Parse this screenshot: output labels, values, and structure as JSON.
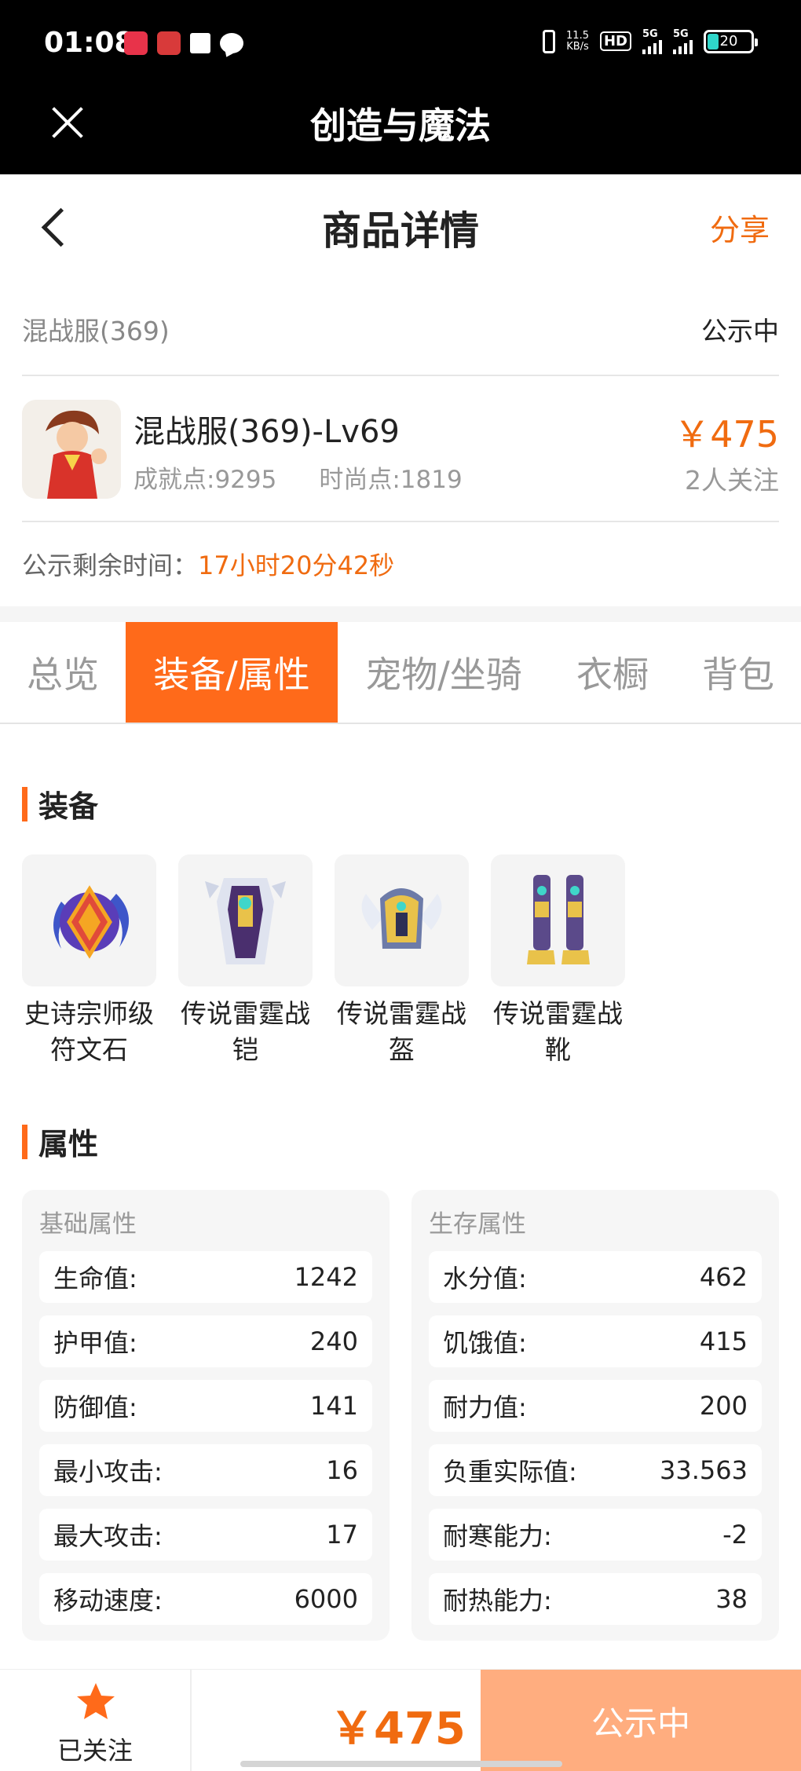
{
  "status_bar": {
    "time": "01:08",
    "speed_value": "11.5",
    "speed_unit": "KB/s",
    "hd": "HD",
    "net1": "5G",
    "net2": "5G",
    "battery": "20"
  },
  "app_bar": {
    "title": "创造与魔法"
  },
  "header": {
    "title": "商品详情",
    "share": "分享"
  },
  "server": {
    "name": "混战服(369)",
    "status": "公示中"
  },
  "product": {
    "title": "混战服(369)-Lv69",
    "achievement": "成就点:9295",
    "fashion": "时尚点:1819",
    "price": "￥475",
    "followers": "2人关注"
  },
  "timer": {
    "label": "公示剩余时间：",
    "value": "17小时20分42秒"
  },
  "tabs": [
    {
      "label": "总览"
    },
    {
      "label": "装备/属性"
    },
    {
      "label": "宠物/坐骑"
    },
    {
      "label": "衣橱"
    },
    {
      "label": "背包"
    }
  ],
  "equipment_section": {
    "title": "装备",
    "items": [
      {
        "line1": "史诗宗师级",
        "line2": "符文石",
        "icon": "rune-stone-icon"
      },
      {
        "line1": "传说雷霆战",
        "line2": "铠",
        "icon": "armor-icon"
      },
      {
        "line1": "传说雷霆战",
        "line2": "盔",
        "icon": "helmet-icon"
      },
      {
        "line1": "传说雷霆战",
        "line2": "靴",
        "icon": "boots-icon"
      }
    ]
  },
  "attributes_section": {
    "title": "属性",
    "basic": {
      "title": "基础属性",
      "rows": [
        {
          "label": "生命值:",
          "value": "1242"
        },
        {
          "label": "护甲值:",
          "value": "240"
        },
        {
          "label": "防御值:",
          "value": "141"
        },
        {
          "label": "最小攻击:",
          "value": "16"
        },
        {
          "label": "最大攻击:",
          "value": "17"
        },
        {
          "label": "移动速度:",
          "value": "6000"
        }
      ]
    },
    "survival": {
      "title": "生存属性",
      "rows": [
        {
          "label": "水分值:",
          "value": "462"
        },
        {
          "label": "饥饿值:",
          "value": "415"
        },
        {
          "label": "耐力值:",
          "value": "200"
        },
        {
          "label": "负重实际值:",
          "value": "33.563"
        },
        {
          "label": "耐寒能力:",
          "value": "-2"
        },
        {
          "label": "耐热能力:",
          "value": "38"
        }
      ]
    }
  },
  "bottom_bar": {
    "follow_label": "已关注",
    "price": "￥475",
    "action": "公示中"
  },
  "colors": {
    "accent": "#ff6a1a",
    "price": "#f06b10",
    "action_button": "#ffad7f"
  }
}
